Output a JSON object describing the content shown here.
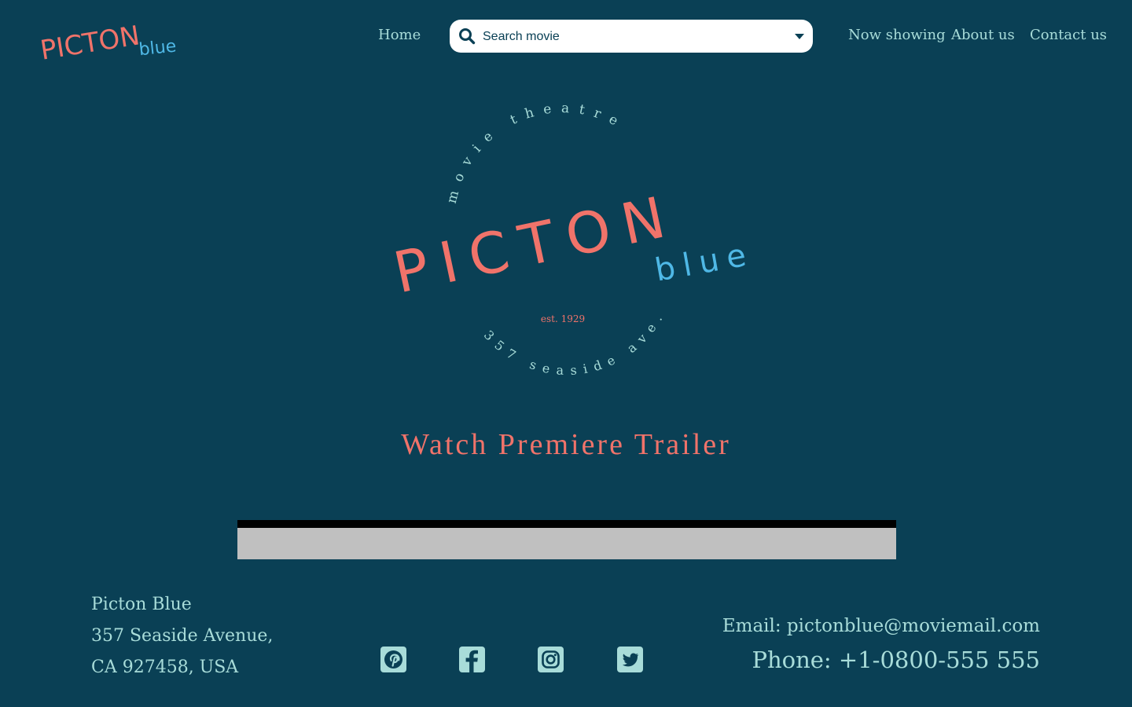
{
  "colors": {
    "background": "#0a4055",
    "accent_coral": "#f0736a",
    "accent_blue": "#4fb8e6",
    "text_mint": "#a8dcd9",
    "white": "#ffffff"
  },
  "brand": {
    "name_main": "PICTON",
    "name_sub": "blue"
  },
  "nav": {
    "home": "Home",
    "now_showing": "Now showing",
    "about": "About us",
    "contact": "Contact us"
  },
  "search": {
    "placeholder": "Search movie",
    "icon": "search-icon",
    "dropdown_icon": "chevron-down-icon"
  },
  "emblem": {
    "arc_top": "movie theatre",
    "main": "PICTON",
    "sub": "blue",
    "established": "est. 1929",
    "arc_bottom": "357 seaside ave."
  },
  "trailer": {
    "title": "Watch Premiere Trailer"
  },
  "footer": {
    "address_line1": "Picton Blue",
    "address_line2": "357 Seaside Avenue,",
    "address_line3": "CA 927458, USA",
    "email": "Email: pictonblue@moviemail.com",
    "phone": "Phone: +1-0800-555 555",
    "social": [
      "pinterest-icon",
      "facebook-icon",
      "instagram-icon",
      "twitter-icon"
    ]
  }
}
